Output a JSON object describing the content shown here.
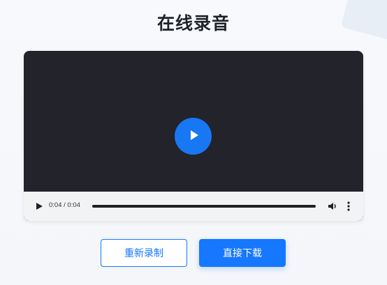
{
  "page": {
    "title": "在线录音"
  },
  "player": {
    "current_time": "0:04",
    "duration": "0:04",
    "time_text": "0:04 / 0:04",
    "progress_fraction": 1.0,
    "colors": {
      "accent": "#1677ff",
      "player_bg": "#22232b",
      "controls_bg": "#f1f3f4"
    },
    "icons": {
      "big_play": "play-icon",
      "play": "play-icon",
      "volume": "volume-icon",
      "more": "more-vertical-icon"
    }
  },
  "actions": {
    "rerecord_label": "重新录制",
    "download_label": "直接下载"
  }
}
